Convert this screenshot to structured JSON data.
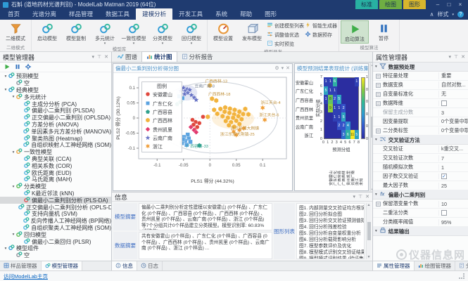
{
  "window": {
    "title": "石斛 (道地药材光谱判别) - ModelLab Matman 2019 (64位)",
    "minimize": "–",
    "maximize": "□",
    "close": "×"
  },
  "contextual_tabs": [
    {
      "label": "标准",
      "color": "#28b0a2"
    },
    {
      "label": "绘图",
      "color": "#6fae43"
    },
    {
      "label": "图形",
      "color": "#d8b62c"
    }
  ],
  "ribbon": {
    "tabs": [
      "首页",
      "光谱分离",
      "样品管理",
      "数据工具",
      "建模分析",
      "开发工具",
      "系统",
      "帮助",
      "图形"
    ],
    "active_tab": "建模分析",
    "right": {
      "style_label": "样式",
      "help_label": "?"
    },
    "groups": [
      {
        "caption": "二维模式",
        "big": [
          {
            "label": "二维模式",
            "icon": "funnel-icon"
          }
        ]
      },
      {
        "caption": "模型库",
        "big": [
          {
            "label": "启动模型",
            "icon": "model-icon"
          },
          {
            "label": "模型复制",
            "icon": "model-icon"
          },
          {
            "label": "多元统计",
            "icon": "model-icon",
            "arrow": true
          },
          {
            "label": "一致性模型",
            "icon": "model-icon",
            "arrow": true
          },
          {
            "label": "分类模型",
            "icon": "model-icon",
            "arrow": true
          },
          {
            "label": "回归模型",
            "icon": "model-icon",
            "arrow": true
          }
        ]
      },
      {
        "caption": "模型开发",
        "big": [
          {
            "label": "模型设置",
            "icon": "gauge-icon"
          },
          {
            "label": "发布模型",
            "icon": "cube-icon"
          }
        ],
        "stacks": [
          [
            {
              "label": "创建模型列表",
              "icon": "list-icon"
            },
            {
              "label": "调整值优选",
              "icon": "tune-icon"
            },
            {
              "label": "实时预览",
              "icon": "preview-icon"
            }
          ],
          [
            {
              "label": "智能生成器",
              "icon": "bolt-icon"
            },
            {
              "label": "数据预存",
              "icon": "gear-icon"
            }
          ]
        ]
      },
      {
        "caption": "模型算法",
        "big": [
          {
            "label": "启动算法",
            "icon": "play-icon",
            "active": true
          },
          {
            "label": "暂停",
            "icon": "pause-icon"
          }
        ]
      }
    ]
  },
  "model_manager": {
    "title": "模型管理器",
    "toolbar": [
      {
        "icon": "play-icon"
      },
      {
        "icon": "pause-icon"
      },
      {
        "icon": "gear-icon"
      }
    ],
    "tree": [
      {
        "d": 0,
        "label": "预测模型",
        "exp": true,
        "ic": "#2e9bd6"
      },
      {
        "d": 1,
        "label": "空",
        "ic": "#8a8f98"
      },
      {
        "d": 0,
        "label": "经典模型",
        "exp": true,
        "ic": "#2e9bd6"
      },
      {
        "d": 1,
        "label": "多元统计",
        "exp": true,
        "ic": "#e8a33d"
      },
      {
        "d": 2,
        "label": "主成分分析 (PCA)",
        "ic": "#49b0dd"
      },
      {
        "d": 2,
        "label": "偏最小二乘判别 (PLSDA)",
        "ic": "#49b0dd"
      },
      {
        "d": 2,
        "label": "正交偏最小二乘判别 (OPLSDA)",
        "ic": "#49b0dd"
      },
      {
        "d": 2,
        "label": "方差分析 (ANOVA)",
        "ic": "#49b0dd"
      },
      {
        "d": 2,
        "label": "单因素多元方差分析 (MANOVA)",
        "ic": "#49b0dd"
      },
      {
        "d": 2,
        "label": "聚类热图 (Heatmap)",
        "ic": "#49b0dd"
      },
      {
        "d": 2,
        "label": "自组织映射人工神经网络 (SOM)",
        "ic": "#49b0dd"
      },
      {
        "d": 1,
        "label": "一致性模型",
        "exp": true,
        "ic": "#e8a33d"
      },
      {
        "d": 2,
        "label": "典型关联 (CCA)",
        "ic": "#49b0dd"
      },
      {
        "d": 2,
        "label": "相关系数 (COR)",
        "ic": "#49b0dd"
      },
      {
        "d": 2,
        "label": "欧氏距离 (EUD)",
        "ic": "#49b0dd"
      },
      {
        "d": 2,
        "label": "马氏距离 (MAH)",
        "ic": "#49b0dd"
      },
      {
        "d": 1,
        "label": "分类模型",
        "exp": true,
        "ic": "#57b94c"
      },
      {
        "d": 2,
        "label": "K最近邻法 (kNN)",
        "ic": "#49b0dd"
      },
      {
        "d": 2,
        "label": "偏最小二乘判别分析 (PLS-DA)",
        "sel": true,
        "ic": "#e05050"
      },
      {
        "d": 2,
        "label": "正交偏最小二乘判别分析 (OPLS-DA)",
        "ic": "#49b0dd"
      },
      {
        "d": 2,
        "label": "支持向量机 (SVM)",
        "ic": "#49b0dd"
      },
      {
        "d": 2,
        "label": "反向传播人工神经网络 (BP网络)",
        "ic": "#49b0dd"
      },
      {
        "d": 2,
        "label": "自组织聚类人工神经网络 (SOM)",
        "ic": "#49b0dd"
      },
      {
        "d": 1,
        "label": "回归模型",
        "exp": true,
        "ic": "#57b94c"
      },
      {
        "d": 2,
        "label": "偏最小二乘回归 (PLSR)",
        "ic": "#49b0dd"
      },
      {
        "d": 0,
        "label": "模型组件",
        "exp": true,
        "ic": "#2e9bd6"
      },
      {
        "d": 1,
        "label": "空",
        "ic": "#8a8f98"
      }
    ],
    "tabs": [
      {
        "label": "样品管理器",
        "icon": "samples-icon"
      },
      {
        "label": "模型管理器",
        "icon": "model-icon",
        "active": true
      }
    ]
  },
  "document_tabs": [
    {
      "label": "图谱",
      "icon": "spectrum-tab-icon"
    },
    {
      "label": "统计图",
      "icon": "stats-tab-icon",
      "active": true
    },
    {
      "label": "分析报告",
      "icon": "report-tab-icon"
    }
  ],
  "chart_data": [
    {
      "type": "scatter",
      "title": "偏最小二乘判别分析得分图",
      "xlabel": "PLS1 得分 (44.32%)",
      "ylabel": "PLS2 得分 (30.12%)",
      "xlim": [
        -0.135,
        0.145
      ],
      "ylim": [
        -0.135,
        0.135
      ],
      "xticks": [
        -0.1,
        -0.05,
        0,
        0.05,
        0.1
      ],
      "yticks": [
        -0.1,
        -0.05,
        0,
        0.05,
        0.1
      ],
      "legend_title": "图例",
      "grid": false,
      "series": [
        {
          "name": "安徽霍山",
          "marker": "circle",
          "color": "#e0483e",
          "points": [
            [
              -0.033,
              -0.006
            ],
            [
              -0.027,
              -0.013
            ],
            [
              -0.031,
              -0.022
            ],
            [
              -0.024,
              -0.03
            ],
            [
              -0.029,
              -0.038
            ],
            [
              -0.02,
              -0.017
            ],
            [
              -0.013,
              0.004
            ]
          ]
        },
        {
          "name": "广东仁化",
          "marker": "square",
          "color": "#5ba3e0",
          "points": [
            [
              -0.042,
              -0.055
            ],
            [
              -0.049,
              -0.063
            ],
            [
              -0.04,
              -0.068
            ],
            [
              -0.047,
              -0.076
            ],
            [
              -0.053,
              -0.083
            ],
            [
              -0.044,
              -0.089
            ],
            [
              -0.037,
              -0.079
            ],
            [
              -0.051,
              -0.07
            ],
            [
              -0.058,
              0.072
            ],
            [
              -0.052,
              0.066
            ]
          ]
        },
        {
          "name": "广西容县",
          "marker": "pentagon",
          "color": "#2fa08c",
          "points": [
            [
              -0.062,
              0.046
            ],
            [
              -0.056,
              0.053
            ],
            [
              -0.02,
              -0.091
            ]
          ]
        },
        {
          "name": "广西西林",
          "marker": "hexagon",
          "color": "#f2b33d",
          "points": [
            [
              0.02,
              0.03
            ],
            [
              0.029,
              0.035
            ],
            [
              0.038,
              0.031
            ],
            [
              0.047,
              0.027
            ],
            [
              0.028,
              0.021
            ],
            [
              0.037,
              0.017
            ],
            [
              0.046,
              0.012
            ],
            [
              0.056,
              0.021
            ],
            [
              0.024,
              0.006
            ],
            [
              0.034,
              0.001
            ],
            [
              0.044,
              0.001
            ],
            [
              0.054,
              0.006
            ],
            [
              0.063,
              0.013
            ],
            [
              0.03,
              -0.01
            ],
            [
              0.04,
              -0.014
            ],
            [
              0.05,
              -0.009
            ],
            [
              0.06,
              -0.004
            ],
            [
              0.036,
              -0.024
            ],
            [
              0.046,
              -0.029
            ],
            [
              0.056,
              -0.02
            ],
            [
              0.067,
              0.03
            ],
            [
              0.073,
              0.012
            ],
            [
              0.008,
              0.027
            ],
            [
              0.014,
              0.014
            ],
            [
              -0.004,
              0.004
            ],
            [
              0.004,
              0.064
            ],
            [
              0.012,
              0.058
            ],
            [
              0.0,
              0.108
            ]
          ]
        },
        {
          "name": "贵州凯里",
          "marker": "diamond",
          "color": "#e23a6e",
          "points": [
            [
              -0.036,
              -0.03
            ],
            [
              -0.03,
              -0.04
            ],
            [
              -0.026,
              -0.047
            ]
          ]
        },
        {
          "name": "云南广南",
          "marker": "star5",
          "color": "#6672c4",
          "points": [
            [
              -0.05,
              0.1
            ],
            [
              -0.043,
              0.096
            ],
            [
              -0.047,
              0.089
            ],
            [
              -0.038,
              0.093
            ],
            [
              -0.042,
              0.083
            ],
            [
              -0.035,
              0.076
            ],
            [
              -0.03,
              0.068
            ],
            [
              -0.026,
              0.06
            ],
            [
              -0.048,
              0.079
            ],
            [
              -0.055,
              0.09
            ]
          ]
        },
        {
          "name": "浙江",
          "marker": "star6",
          "color": "#f0a03c",
          "points": [
            [
              0.1,
              0.034
            ],
            [
              0.104,
              -0.006
            ],
            [
              0.045,
              -0.045
            ],
            [
              0.056,
              -0.04
            ],
            [
              0.05,
              -0.056
            ],
            [
              0.064,
              -0.034
            ]
          ]
        }
      ],
      "annotations": [
        {
          "text": "广西西林-13",
          "x": 0.012,
          "y": 0.117,
          "color": "#c0903a"
        },
        {
          "text": "云南广南-8",
          "x": -0.01,
          "y": 0.101,
          "color": "#7a8699"
        },
        {
          "text": "广西西林-18",
          "x": 0.018,
          "y": 0.074,
          "color": "#c0903a"
        },
        {
          "text": "浙江天台-4",
          "x": 0.115,
          "y": 0.046,
          "color": "#c0903a"
        },
        {
          "text": "浙江天台-6",
          "x": 0.112,
          "y": 0.006,
          "color": "#c0903a"
        },
        {
          "text": "浙江乐清大荆镇",
          "x": 0.066,
          "y": -0.038,
          "color": "#c0903a"
        },
        {
          "text": "浙江乐清大荆镇-25",
          "x": 0.052,
          "y": -0.058,
          "color": "#c0903a"
        },
        {
          "text": "广西容县-33",
          "x": -0.024,
          "y": -0.098,
          "color": "#2fa08c"
        }
      ],
      "ellipse": {
        "cx": 0.01,
        "cy": 0.002,
        "r": 0.118
      },
      "hulls": [
        {
          "cx": 0.044,
          "cy": -0.002,
          "rx": 0.04,
          "ry": 0.034,
          "color": "#f2b33d"
        },
        {
          "cx": -0.044,
          "cy": 0.084,
          "rx": 0.02,
          "ry": 0.026,
          "color": "#6672c4"
        }
      ]
    },
    {
      "type": "heatmap",
      "title": "模型预测结果表现统计 (训练集)",
      "xlabel": "预测分组",
      "ylabel": "实际分组",
      "rows": [
        "安徽霍山",
        "广东仁化",
        "广西容县",
        "广西西林",
        "贵州凯里",
        "云南广南",
        "浙江"
      ],
      "cols": [
        "安徽霍山",
        "广东仁化",
        "广西容县",
        "广西西林",
        "贵州凯里",
        "云南广南",
        "浙江",
        "未知"
      ],
      "xticks": [
        0,
        1,
        2,
        3,
        4,
        5,
        6,
        7,
        8
      ],
      "yticks": [
        0,
        1,
        2,
        3,
        4,
        5,
        6,
        7
      ],
      "vmax": 11,
      "bg_value": 0,
      "cells": [
        {
          "r": 0,
          "c": 0,
          "v": 1
        },
        {
          "r": 0,
          "c": 1,
          "v": 1
        },
        {
          "r": 0,
          "c": 2,
          "v": 6
        },
        {
          "r": 0,
          "c": 7,
          "v": 1
        },
        {
          "r": 1,
          "c": 0,
          "v": 5
        },
        {
          "r": 1,
          "c": 1,
          "v": 1
        },
        {
          "r": 1,
          "c": 2,
          "v": 1
        },
        {
          "r": 2,
          "c": 0,
          "v": 1
        },
        {
          "r": 2,
          "c": 1,
          "v": 8
        },
        {
          "r": 2,
          "c": 2,
          "v": 2
        },
        {
          "r": 2,
          "c": 3,
          "v": 5
        },
        {
          "r": 3,
          "c": 1,
          "v": 9
        },
        {
          "r": 3,
          "c": 2,
          "v": 1
        },
        {
          "r": 3,
          "c": 3,
          "v": 1
        },
        {
          "r": 3,
          "c": 4,
          "v": 2
        },
        {
          "r": 4,
          "c": 2,
          "v": 1
        },
        {
          "r": 4,
          "c": 3,
          "v": 1
        },
        {
          "r": 4,
          "c": 4,
          "v": 5
        },
        {
          "r": 5,
          "c": 3,
          "v": 2
        },
        {
          "r": 5,
          "c": 4,
          "v": 2
        },
        {
          "r": 5,
          "c": 5,
          "v": 4
        },
        {
          "r": 6,
          "c": 4,
          "v": 3
        },
        {
          "r": 6,
          "c": 5,
          "v": 6
        },
        {
          "r": 6,
          "c": 6,
          "v": 11
        },
        {
          "r": 6,
          "c": 7,
          "v": 5
        }
      ],
      "colorbar": {
        "ticks": [
          1,
          0.8,
          0.6,
          0.4,
          0.2,
          0
        ],
        "stops": [
          "#2b2da0",
          "#3556cc",
          "#2e9ad0",
          "#30b894",
          "#86c93e",
          "#f5e626"
        ]
      }
    }
  ],
  "info": {
    "title": "信息",
    "rows": [
      {
        "label": "模型摘要",
        "text": "偏最小二乘判别分析定性建模以安徽霍山 (0个样品) 、广东仁化 (0个样品) 、广西容县 (0个样品) 、广西西林 (0个样品) 、贵州凯里 (0个样品) 、云南广南 (0个样品) 、浙江 (0个样品) 等7个分组共计0个样品建立分类模型。模型识别率: 60.83% (训练集) 。"
      },
      {
        "label": "数据摘要",
        "text": "共有安徽霍山 (0个样品) 、广东仁化 (0个样品) 、广西容县 (0个样品) 、广西西林 (0个样品) 、贵州凯里 (0个样品) 、云南广南 (0个样品) 、浙江 (0个样品) ..."
      }
    ],
    "figures_label": "图形列表",
    "figures": [
      "图1. 内部测量交叉验证均方根误差法 (RMSECV)",
      "图2. 回归分析拟合图",
      "图3. 回归分析交叉验证预测值拟合图",
      "图4. 回归分析残差检验",
      "图5. 回归分析自变量权重分析",
      "图6. 回归分析载荷影响分析",
      "图7. 模型参数评价及优化",
      "图8. 模型模式识别交叉验证结果 (训练集)",
      "图9. 模型模式识别结果 (验证集)"
    ],
    "tabs": [
      {
        "label": "信息",
        "icon": "info-icon",
        "active": true
      },
      {
        "label": "日志",
        "icon": "log-icon"
      }
    ]
  },
  "properties": {
    "title": "属性管理器",
    "sections": [
      {
        "title": "数据预处理",
        "icon": "filter-icon",
        "rows": [
          {
            "ic": "sliders-icon",
            "label": "特征量处理",
            "value": "重要"
          },
          {
            "ic": "wave-icon",
            "label": "数据变换",
            "value": "自然对数..."
          },
          {
            "ic": "norm-icon",
            "label": "自变量标准化",
            "value": "无"
          },
          {
            "ic": "reduce-icon",
            "label": "数据降维",
            "check": "empty"
          },
          {
            "sub": true,
            "label": "保留主成分数",
            "value": "3"
          },
          {
            "label": "因变量提取",
            "value": "0个变量中取"
          },
          {
            "ic": "tag-icon",
            "label": "二分类标签",
            "value": "0个变量中取"
          }
        ]
      },
      {
        "title": "交叉验证方法",
        "icon": "shuffle-icon",
        "rows": [
          {
            "label": "交叉验证",
            "value": "k重交叉..."
          },
          {
            "label": "交叉验证次数",
            "value": "7"
          },
          {
            "label": "随机模拟次数",
            "value": "1"
          },
          {
            "label": "因子数交叉验证",
            "check": "checked"
          },
          {
            "label": "最大因子数",
            "value": "25"
          }
        ]
      },
      {
        "title": "偏最小二乘判别",
        "icon": "fx-icon",
        "rows": [
          {
            "ic": "count-icon",
            "label": "保留潜变量个数",
            "value": "10"
          },
          {
            "label": "二重法分类",
            "check": "empty"
          },
          {
            "label": "分类概率阈值",
            "value": "95%"
          }
        ]
      },
      {
        "title": "结果输出",
        "icon": "output-icon",
        "rows": []
      }
    ],
    "tabs": [
      {
        "label": "属性管理器",
        "icon": "props-icon",
        "active": true
      },
      {
        "label": "绘图管理器",
        "icon": "stats-tab-icon"
      },
      {
        "label": "分析报告向导",
        "icon": "report-tab-icon"
      }
    ]
  },
  "statusbar": {
    "link": "访问ModelLab主页"
  },
  "watermark": {
    "text": "仪器信息网"
  }
}
